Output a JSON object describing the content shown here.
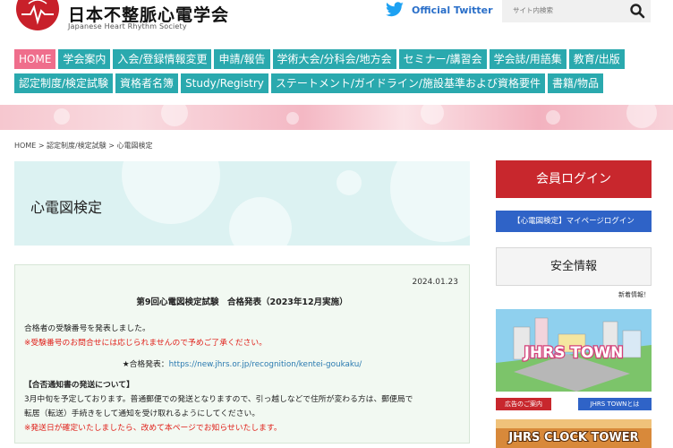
{
  "header": {
    "title": "日本不整脈心電学会",
    "subtitle": "Japanese Heart Rhythm Society",
    "twitter_label": "Official Twitter",
    "search_placeholder": "サイト内検索"
  },
  "nav": {
    "row1": [
      "HOME",
      "学会案内",
      "入会/登録情報変更",
      "申請/報告",
      "学術大会/分科会/地方会",
      "セミナー/講習会",
      "学会誌/用語集",
      "教育/出版"
    ],
    "row2": [
      "認定制度/検定試験",
      "資格者名簿",
      "Study/Registry",
      "ステートメント/ガイドライン/施設基準および資格要件",
      "書籍/物品"
    ],
    "active_index": 0
  },
  "breadcrumb": "HOME > 認定制度/検定試験 > 心電図検定",
  "page_title": "心電図検定",
  "notice": {
    "date": "2024.01.23",
    "heading": "第9回心電図検定試験　合格発表（2023年12月実施）",
    "line1": "合格者の受験番号を発表しました。",
    "line2": "※受験番号のお問合せには応じられませんので予めご了承ください。",
    "link_prefix": "★合格発表：",
    "link_url": "https://new.jhrs.or.jp/recognition/kentei-goukaku/",
    "section_head": "【合否通知書の発送について】",
    "line3": "3月中旬を予定しております。普通郵便での発送となりますので、引っ越しなどで住所が変わる方は、郵便局で",
    "line4": "転居（転送）手続きをして通知を受け取れるようにしてください。",
    "line5": "※発送日が確定いたしましたら、改めて本ページでお知らせいたします。"
  },
  "sidebar": {
    "login_label": "会員ログイン",
    "mypage_label": "【心電図検定】マイページログイン",
    "safety_label": "安全情報",
    "new_info_label": "新着情報！",
    "town_banner_text": "JHRS TOWN",
    "town_tag_left": "広告のご案内",
    "town_tag_right": "JHRS TOWNとは",
    "clock_banner_text": "JHRS CLOCK TOWER"
  },
  "colors": {
    "nav": "#2aa9ae",
    "nav_active": "#ef6e8c",
    "brand_red": "#c8272d",
    "link_blue": "#2a7ab0",
    "notice_red": "#e0201a"
  }
}
